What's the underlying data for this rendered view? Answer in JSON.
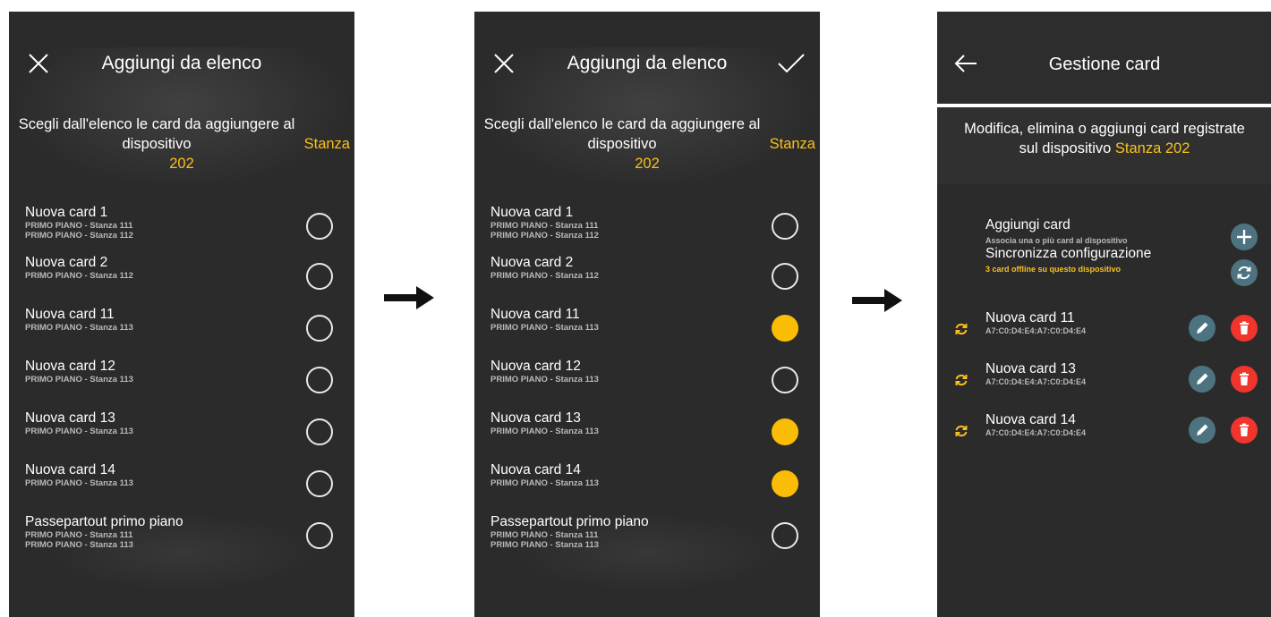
{
  "screens": [
    {
      "title": "Aggiungi da elenco",
      "intro_prefix": "Scegli dall'elenco le card da aggiungere al dispositivo",
      "intro_accent": "Stanza 202",
      "show_check": false,
      "items": [
        {
          "title": "Nuova card 1",
          "sub1": "PRIMO PIANO - Stanza 111",
          "sub2": "PRIMO PIANO - Stanza 112",
          "selected": false
        },
        {
          "title": "Nuova card 2",
          "sub1": "PRIMO PIANO - Stanza 112",
          "sub2": "",
          "selected": false
        },
        {
          "title": "Nuova card 11",
          "sub1": "PRIMO PIANO - Stanza 113",
          "sub2": "",
          "selected": false
        },
        {
          "title": "Nuova card 12",
          "sub1": "PRIMO PIANO - Stanza 113",
          "sub2": "",
          "selected": false
        },
        {
          "title": "Nuova card 13",
          "sub1": "PRIMO PIANO - Stanza 113",
          "sub2": "",
          "selected": false
        },
        {
          "title": "Nuova card 14",
          "sub1": "PRIMO PIANO - Stanza 113",
          "sub2": "",
          "selected": false
        },
        {
          "title": "Passepartout primo piano",
          "sub1": "PRIMO PIANO - Stanza 111",
          "sub2": "PRIMO PIANO - Stanza 113",
          "selected": false
        }
      ]
    },
    {
      "title": "Aggiungi da elenco",
      "intro_prefix": "Scegli dall'elenco le card da aggiungere al dispositivo",
      "intro_accent": "Stanza 202",
      "show_check": true,
      "items": [
        {
          "title": "Nuova card 1",
          "sub1": "PRIMO PIANO - Stanza 111",
          "sub2": "PRIMO PIANO - Stanza 112",
          "selected": false
        },
        {
          "title": "Nuova card 2",
          "sub1": "PRIMO PIANO - Stanza 112",
          "sub2": "",
          "selected": false
        },
        {
          "title": "Nuova card 11",
          "sub1": "PRIMO PIANO - Stanza 113",
          "sub2": "",
          "selected": true
        },
        {
          "title": "Nuova card 12",
          "sub1": "PRIMO PIANO - Stanza 113",
          "sub2": "",
          "selected": false
        },
        {
          "title": "Nuova card 13",
          "sub1": "PRIMO PIANO - Stanza 113",
          "sub2": "",
          "selected": true
        },
        {
          "title": "Nuova card 14",
          "sub1": "PRIMO PIANO - Stanza 113",
          "sub2": "",
          "selected": true
        },
        {
          "title": "Passepartout primo piano",
          "sub1": "PRIMO PIANO - Stanza 111",
          "sub2": "PRIMO PIANO - Stanza 113",
          "selected": false
        }
      ]
    }
  ],
  "manage": {
    "title": "Gestione card",
    "intro_line1": "Modifica, elimina o aggiungi card registrate",
    "intro_line2_prefix": "sul dispositivo",
    "intro_accent": "Stanza 202",
    "add": {
      "title": "Aggiungi card",
      "sub": "Associa una o più card al dispositivo"
    },
    "sync": {
      "title": "Sincronizza configurazione",
      "sub": "3 card offline su questo dispositivo"
    },
    "cards": [
      {
        "title": "Nuova card 11",
        "sub": "A7:C0:D4:E4:A7:C0:D4:E4"
      },
      {
        "title": "Nuova card 13",
        "sub": "A7:C0:D4:E4:A7:C0:D4:E4"
      },
      {
        "title": "Nuova card 14",
        "sub": "A7:C0:D4:E4:A7:C0:D4:E4"
      }
    ]
  },
  "colors": {
    "accent": "#f9c11a",
    "selected_radio": "#fbbc05",
    "edit_button": "#4d7381",
    "delete_button": "#f0352c",
    "add_button": "#4d7381",
    "background": "#2b2b2b"
  },
  "icons": {
    "close": "close-icon",
    "check": "check-icon",
    "back": "arrow-left-icon",
    "add": "plus-icon",
    "sync": "sync-icon",
    "edit": "pencil-icon",
    "delete": "trash-icon",
    "flow_arrow": "arrow-right-icon"
  }
}
